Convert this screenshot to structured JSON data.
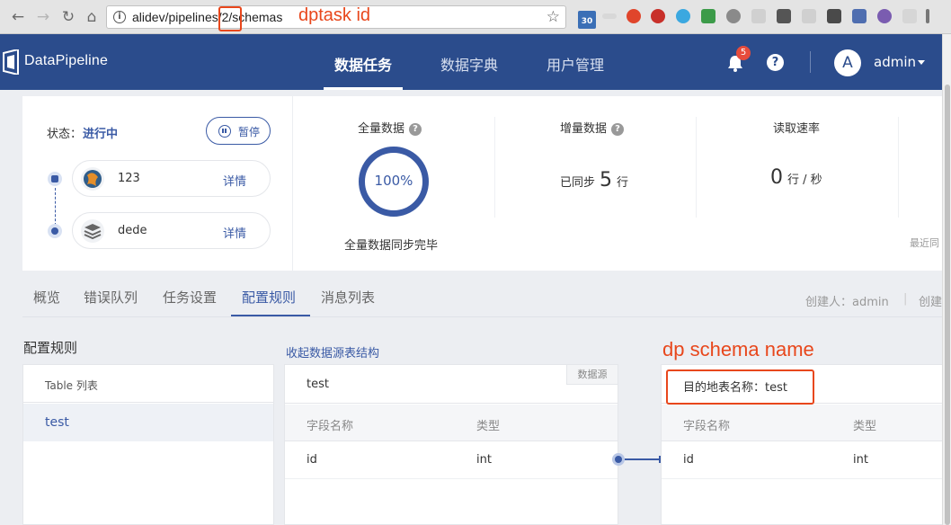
{
  "browser": {
    "url": "alidev/pipelines/2/schemas",
    "badge": "30"
  },
  "annotations": {
    "task_id": "dptask id",
    "schema_name": "dp schema name"
  },
  "header": {
    "logo": "DataPipeline",
    "nav": [
      "数据任务",
      "数据字典",
      "用户管理"
    ],
    "notifications": "5",
    "help": "?",
    "avatar": "A",
    "user": "admin"
  },
  "status": {
    "label": "状态：",
    "value": "进行中",
    "pause": "暂停",
    "source": {
      "name": "123",
      "detail": "详情"
    },
    "target": {
      "name": "dede",
      "detail": "详情"
    }
  },
  "metrics": {
    "full": {
      "title": "全量数据",
      "percent": "100%",
      "caption": "全量数据同步完毕"
    },
    "incremental": {
      "title": "增量数据",
      "prefix": "已同步",
      "value": "5",
      "unit": "行"
    },
    "rate": {
      "title": "读取速率",
      "value": "0",
      "unit": "行 / 秒"
    },
    "recent": "最近同"
  },
  "tabs": [
    "概览",
    "错误队列",
    "任务设置",
    "配置规则",
    "消息列表"
  ],
  "creator": {
    "label": "创建人：admin",
    "sep": "|",
    "more": "创建"
  },
  "config": {
    "title": "配置规则",
    "collapse": "收起数据源表结构",
    "table_list": {
      "header": "Table 列表",
      "items": [
        "test"
      ]
    },
    "source": {
      "name": "test",
      "tag": "数据源",
      "col_name": "字段名称",
      "col_type": "类型",
      "rows": [
        {
          "name": "id",
          "type": "int"
        }
      ]
    },
    "target": {
      "name": "目的地表名称：test",
      "col_name": "字段名称",
      "col_type": "类型",
      "rows": [
        {
          "name": "id",
          "type": "int"
        }
      ]
    }
  },
  "colors": {
    "brand": "#2b4c8c",
    "accent": "#3a5aa5",
    "annotation": "#e8471c"
  }
}
